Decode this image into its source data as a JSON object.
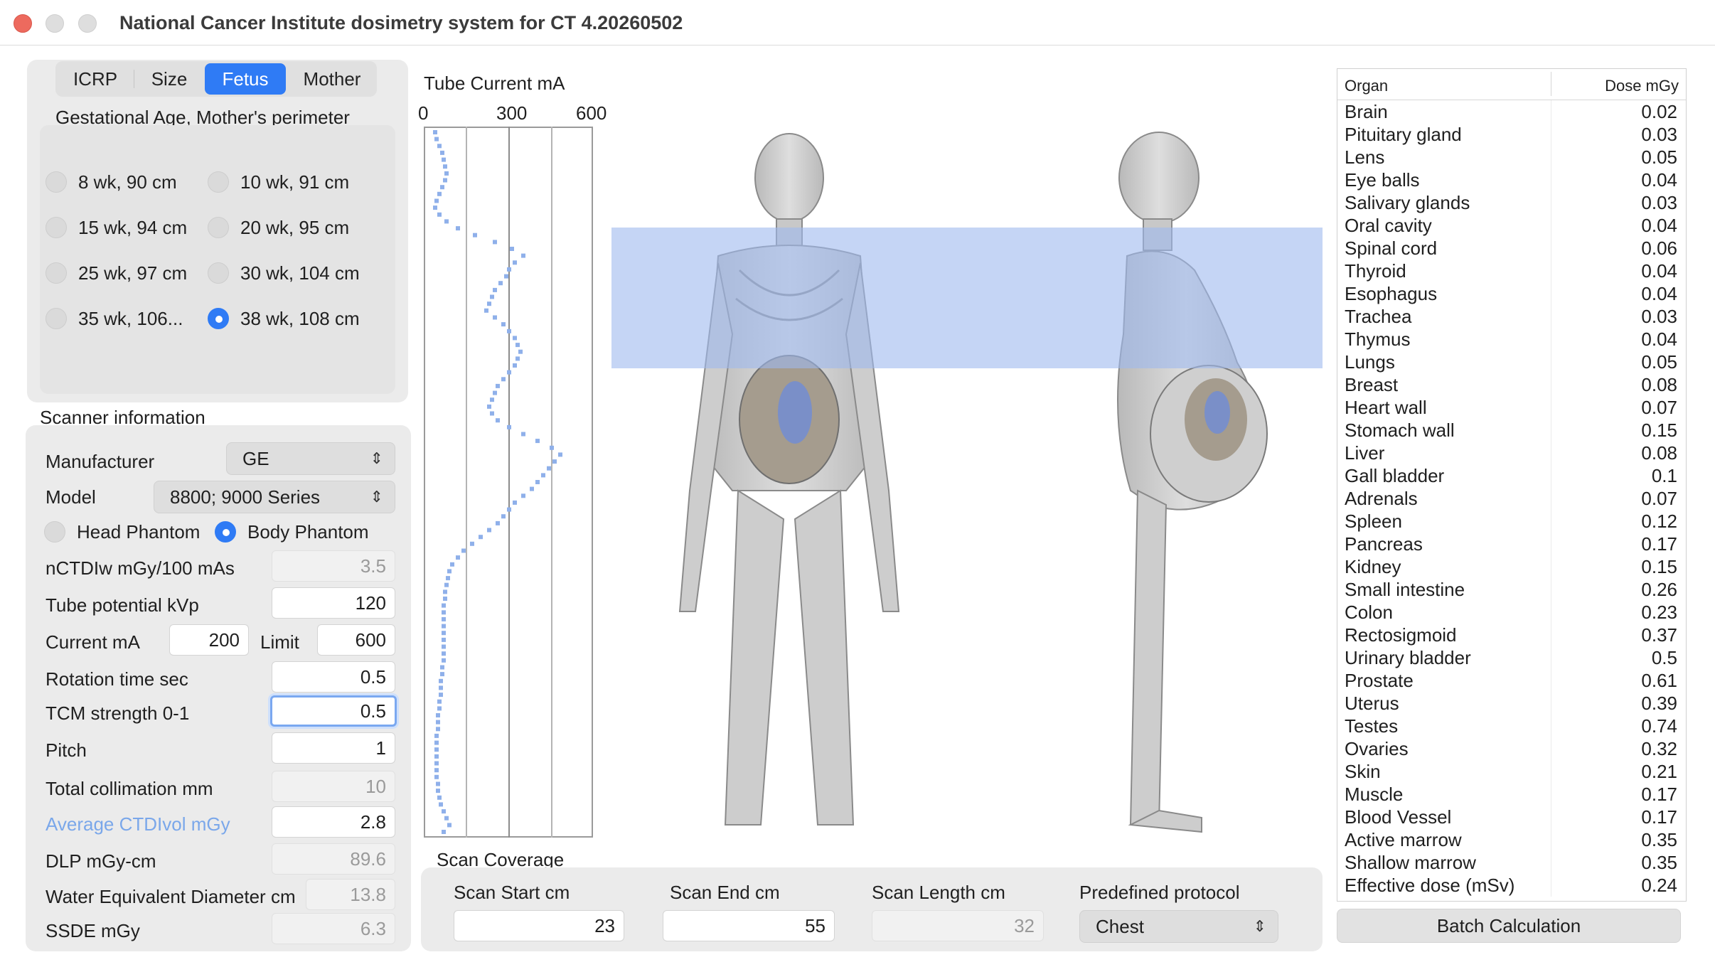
{
  "window": {
    "title": "National Cancer Institute dosimetry system for CT 4.20260502"
  },
  "phantom_tabs": [
    {
      "label": "ICRP",
      "selected": false
    },
    {
      "label": "Size",
      "selected": false
    },
    {
      "label": "Fetus",
      "selected": true
    },
    {
      "label": "Mother",
      "selected": false
    }
  ],
  "gestation": {
    "label": "Gestational Age, Mother's perimeter",
    "options": [
      {
        "label": "8 wk, 90 cm",
        "selected": false
      },
      {
        "label": "10 wk, 91 cm",
        "selected": false
      },
      {
        "label": "15 wk, 94 cm",
        "selected": false
      },
      {
        "label": "20 wk, 95 cm",
        "selected": false
      },
      {
        "label": "25 wk, 97 cm",
        "selected": false
      },
      {
        "label": "30 wk, 104 cm",
        "selected": false
      },
      {
        "label": "35 wk, 106...",
        "selected": false
      },
      {
        "label": "38 wk, 108 cm",
        "selected": true
      }
    ]
  },
  "scanner": {
    "section_label": "Scanner information",
    "manufacturer_label": "Manufacturer",
    "manufacturer_value": "GE",
    "model_label": "Model",
    "model_value": "8800; 9000 Series",
    "head_phantom_label": "Head Phantom",
    "body_phantom_label": "Body Phantom",
    "phantom_type_selected": "Body Phantom",
    "nctdiw_label": "nCTDIw mGy/100 mAs",
    "nctdiw_value": "3.5",
    "kvp_label": "Tube potential kVp",
    "kvp_value": "120",
    "current_label": "Current mA",
    "current_value": "200",
    "limit_label": "Limit",
    "limit_value": "600",
    "rotation_label": "Rotation time sec",
    "rotation_value": "0.5",
    "tcm_label": "TCM strength 0-1",
    "tcm_value": "0.5",
    "pitch_label": "Pitch",
    "pitch_value": "1",
    "collimation_label": "Total collimation mm",
    "collimation_value": "10",
    "ctdivol_label": "Average CTDIvol mGy",
    "ctdivol_value": "2.8",
    "dlp_label": "DLP mGy-cm",
    "dlp_value": "89.6",
    "wed_label": "Water Equivalent Diameter cm",
    "wed_value": "13.8",
    "ssde_label": "SSDE mGy",
    "ssde_value": "6.3"
  },
  "tube_current": {
    "title": "Tube Current mA",
    "ticks": [
      "0",
      "300",
      "600"
    ]
  },
  "chart_data": {
    "type": "line",
    "title": "Tube Current mA",
    "xlim": [
      0,
      600
    ],
    "xticks": [
      0,
      300,
      600
    ],
    "orientation": "vertical profile (z along body, top to bottom)",
    "grid": true,
    "values_ma": [
      40,
      45,
      55,
      65,
      70,
      75,
      80,
      75,
      65,
      55,
      45,
      40,
      55,
      80,
      120,
      180,
      250,
      310,
      350,
      320,
      300,
      290,
      270,
      250,
      240,
      230,
      220,
      250,
      280,
      300,
      320,
      330,
      340,
      330,
      320,
      300,
      280,
      260,
      250,
      240,
      230,
      240,
      260,
      300,
      350,
      400,
      450,
      480,
      460,
      440,
      420,
      400,
      380,
      350,
      320,
      300,
      280,
      260,
      230,
      200,
      170,
      140,
      120,
      100,
      90,
      85,
      80,
      75,
      75,
      70,
      70,
      70,
      70,
      70,
      70,
      70,
      70,
      70,
      65,
      65,
      60,
      60,
      60,
      55,
      55,
      50,
      50,
      50,
      45,
      45,
      45,
      45,
      45,
      45,
      45,
      50,
      50,
      55,
      60,
      70,
      80,
      90,
      70
    ]
  },
  "scan_overlay": {
    "start_cm": 23,
    "end_cm": 55,
    "color": "#9fb9ef"
  },
  "coverage": {
    "label": "Scan Coverage",
    "start_label": "Scan Start cm",
    "start_value": "23",
    "end_label": "Scan End cm",
    "end_value": "55",
    "length_label": "Scan Length cm",
    "length_value": "32",
    "protocol_label": "Predefined protocol",
    "protocol_value": "Chest"
  },
  "dose_table": {
    "col_organ": "Organ",
    "col_dose": "Dose mGy",
    "rows": [
      {
        "organ": "Brain",
        "dose": "0.02"
      },
      {
        "organ": "Pituitary gland",
        "dose": "0.03"
      },
      {
        "organ": "Lens",
        "dose": "0.05"
      },
      {
        "organ": "Eye balls",
        "dose": "0.04"
      },
      {
        "organ": "Salivary glands",
        "dose": "0.03"
      },
      {
        "organ": "Oral cavity",
        "dose": "0.04"
      },
      {
        "organ": "Spinal cord",
        "dose": "0.06"
      },
      {
        "organ": "Thyroid",
        "dose": "0.04"
      },
      {
        "organ": "Esophagus",
        "dose": "0.04"
      },
      {
        "organ": "Trachea",
        "dose": "0.03"
      },
      {
        "organ": "Thymus",
        "dose": "0.04"
      },
      {
        "organ": "Lungs",
        "dose": "0.05"
      },
      {
        "organ": "Breast",
        "dose": "0.08"
      },
      {
        "organ": "Heart wall",
        "dose": "0.07"
      },
      {
        "organ": "Stomach wall",
        "dose": "0.15"
      },
      {
        "organ": "Liver",
        "dose": "0.08"
      },
      {
        "organ": "Gall bladder",
        "dose": "0.1"
      },
      {
        "organ": "Adrenals",
        "dose": "0.07"
      },
      {
        "organ": "Spleen",
        "dose": "0.12"
      },
      {
        "organ": "Pancreas",
        "dose": "0.17"
      },
      {
        "organ": "Kidney",
        "dose": "0.15"
      },
      {
        "organ": "Small intestine",
        "dose": "0.26"
      },
      {
        "organ": "Colon",
        "dose": "0.23"
      },
      {
        "organ": "Rectosigmoid",
        "dose": "0.37"
      },
      {
        "organ": "Urinary bladder",
        "dose": "0.5"
      },
      {
        "organ": "Prostate",
        "dose": "0.61"
      },
      {
        "organ": "Uterus",
        "dose": "0.39"
      },
      {
        "organ": "Testes",
        "dose": "0.74"
      },
      {
        "organ": "Ovaries",
        "dose": "0.32"
      },
      {
        "organ": "Skin",
        "dose": "0.21"
      },
      {
        "organ": "Muscle",
        "dose": "0.17"
      },
      {
        "organ": "Blood Vessel",
        "dose": "0.17"
      },
      {
        "organ": "Active marrow",
        "dose": "0.35"
      },
      {
        "organ": "Shallow marrow",
        "dose": "0.35"
      },
      {
        "organ": "Effective dose (mSv)",
        "dose": "0.24"
      }
    ]
  },
  "batch": {
    "label": "Batch Calculation"
  }
}
